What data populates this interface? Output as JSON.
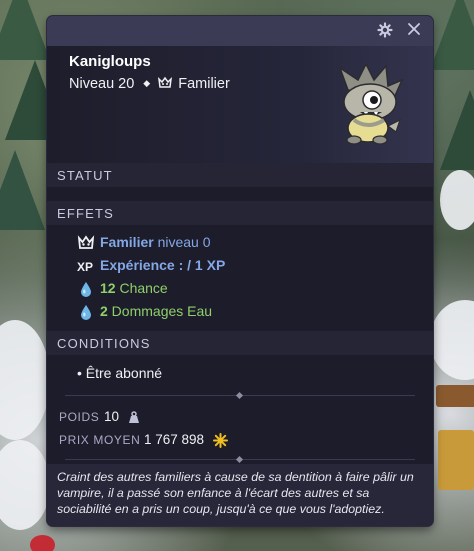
{
  "item": {
    "name": "Kanigloups",
    "level": "Niveau 20",
    "type": "Familier"
  },
  "window": {
    "settings_icon": "gear-icon",
    "close_icon": "close-icon"
  },
  "sections": {
    "statut": "STATUT",
    "effets": "EFFETS",
    "conditions": "CONDITIONS"
  },
  "effects": [
    {
      "icon": "pet-icon",
      "bold": "Familier",
      "rest": " niveau 0",
      "color": "#84a7e6"
    },
    {
      "icon": "xp-icon",
      "bold": "",
      "rest": "Expérience :  / 1 XP",
      "color": "#84a7e6"
    },
    {
      "icon": "water-drop-icon",
      "bold": "12",
      "rest": " Chance",
      "color": "#8fd06a"
    },
    {
      "icon": "water-drop-icon",
      "bold": "2",
      "rest": " Dommages Eau",
      "color": "#8fd06a"
    }
  ],
  "conditions": [
    "• Être abonné"
  ],
  "meta": {
    "poids_label": "POIDS",
    "poids_value": "10",
    "prix_label": "PRIX MOYEN",
    "prix_value": "1 767 898"
  },
  "description": "Craint des autres familiers à cause de sa dentition à faire pâlir un vampire, il a passé son enfance à l'écart des autres et sa sociabilité en a pris un coup, jusqu'à ce que vous l'adoptiez.",
  "colors": {
    "panel_bg": "#1c1c2a",
    "titlebar": "#3b3b55",
    "effect_blue": "#84a7e6",
    "effect_green": "#8fd06a",
    "kama_gold": "#f0c020"
  }
}
